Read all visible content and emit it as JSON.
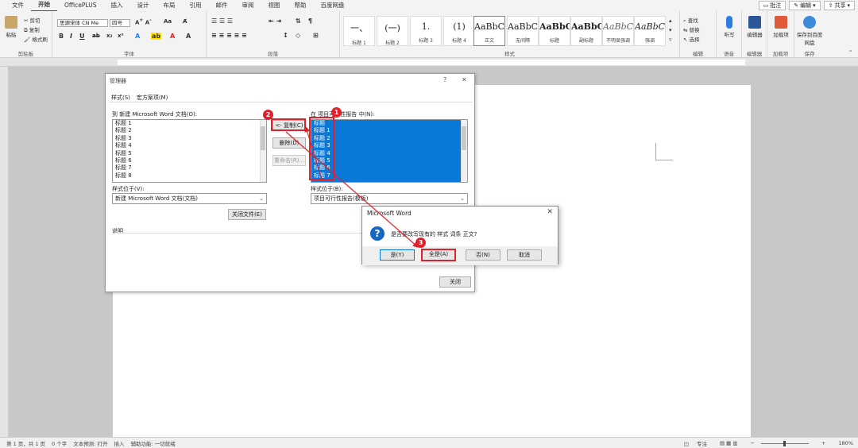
{
  "tabs": [
    "文件",
    "开始",
    "OfficePLUS",
    "插入",
    "设计",
    "布局",
    "引用",
    "邮件",
    "审阅",
    "视图",
    "帮助",
    "百度网盘"
  ],
  "tabs_right": {
    "comment": "批注",
    "edit": "编辑",
    "share": "共享"
  },
  "ribbon": {
    "clipboard": {
      "paste": "粘贴",
      "cut": "剪切",
      "copy": "复制",
      "painter": "格式刷",
      "label": "剪贴板"
    },
    "font": {
      "name": "思源宋体 CN Me",
      "size": "四号",
      "label": "字体"
    },
    "paragraph": {
      "label": "段落"
    },
    "styles": {
      "label": "样式",
      "items": [
        {
          "sample": "一、",
          "name": "标题 1"
        },
        {
          "sample": "(一)",
          "name": "标题 2"
        },
        {
          "sample": "1.",
          "name": "标题 3"
        },
        {
          "sample": "(1)",
          "name": "标题 4"
        },
        {
          "sample": "AaBbC",
          "name": "正文"
        },
        {
          "sample": "AaBbC",
          "name": "无间隔"
        },
        {
          "sample": "AaBbC",
          "name": "标题"
        },
        {
          "sample": "AaBbC",
          "name": "副标题"
        },
        {
          "sample": "AaBbC",
          "name": "不明显强调"
        },
        {
          "sample": "AaBbC",
          "name": "强调"
        }
      ]
    },
    "editing": {
      "find": "查找",
      "replace": "替换",
      "select": "选择",
      "label": "编辑"
    },
    "voice": {
      "dictate": "听写",
      "label": "语音"
    },
    "editor": {
      "name": "编辑器",
      "label": "编辑器"
    },
    "addins": {
      "name": "加载项",
      "label": "加载项"
    },
    "save": {
      "name": "保存到百度网盘",
      "label": "保存"
    }
  },
  "organizer": {
    "title": "管理器",
    "tab_styles": "样式(S)",
    "tab_macros": "宏方案项(M)",
    "left_label": "到 新建 Microsoft Word 文档(O):",
    "left_items": [
      "标题 1",
      "标题 2",
      "标题 3",
      "标题 4",
      "标题 5",
      "标题 6",
      "标题 7",
      "标题 8"
    ],
    "right_label": "在 项目可行性报告 中(N):",
    "right_items": [
      "标题",
      "标题 1",
      "标题 2",
      "标题 3",
      "标题 4",
      "标题 5",
      "标题 6",
      "标题 7"
    ],
    "copy_btn": "<- 复制(C)",
    "delete_btn": "删除(D)",
    "rename_btn": "重命名(R)...",
    "left_avail_label": "样式位于(V):",
    "left_avail_value": "新建 Microsoft Word 文档(文档)",
    "right_avail_label": "样式位于(B):",
    "right_avail_value": "项目可行性报告(模板)",
    "close_file_btn": "关闭文件(E)",
    "desc_label": "说明",
    "close_btn": "关闭"
  },
  "confirm": {
    "title": "Microsoft Word",
    "message": "是否要改写现有的 样式 词条 正文?",
    "yes": "是(Y)",
    "yes_all": "全是(A)",
    "no": "否(N)",
    "cancel": "取消"
  },
  "badges": [
    "1",
    "2",
    "3"
  ],
  "status": {
    "page": "第 1 页，共 1 页",
    "words": "0 个字",
    "predict": "文本预测: 打开",
    "insert": "插入",
    "access": "辅助功能: 一切就绪",
    "focus": "专注",
    "zoom": "180%"
  },
  "colors": {
    "accent": "#2b579a",
    "selection": "#0a78d7",
    "annotation": "#e0202a"
  }
}
